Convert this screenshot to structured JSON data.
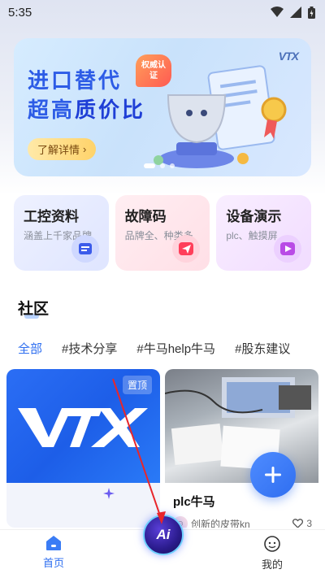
{
  "status_bar": {
    "time": "5:35",
    "icons": [
      "wifi-icon",
      "signal-icon",
      "battery-icon"
    ]
  },
  "banner": {
    "line1": "进口替代",
    "line2_prefix": "超高",
    "line2_highlight": "质价比",
    "badge": "权威认证",
    "button": "了解详情",
    "logo": "VTX",
    "dots": 3,
    "active_dot": 0
  },
  "features": [
    {
      "title": "工控资料",
      "subtitle": "涵盖上千家品牌",
      "icon": "book-icon",
      "color": "#3b5bea"
    },
    {
      "title": "故障码",
      "subtitle": "品牌全、种类多",
      "icon": "send-icon",
      "color": "#ff3f5a"
    },
    {
      "title": "设备演示",
      "subtitle": "plc、触摸屏",
      "icon": "play-icon",
      "color": "#b94be6"
    }
  ],
  "community": {
    "title": "社区",
    "tabs": [
      "全部",
      "#技术分享",
      "#牛马help牛马",
      "#股东建议"
    ],
    "active_tab": 0
  },
  "posts": [
    {
      "pin_label": "置顶",
      "ai_text": "AI"
    },
    {
      "title": "plc牛马",
      "author": "创新的皮带kn",
      "likes": "3"
    }
  ],
  "bottom_nav": {
    "home": "首页",
    "center": "Ai",
    "mine": "我的"
  },
  "colors": {
    "accent": "#2d6ef0",
    "banner_text": "#2d5ce6"
  }
}
